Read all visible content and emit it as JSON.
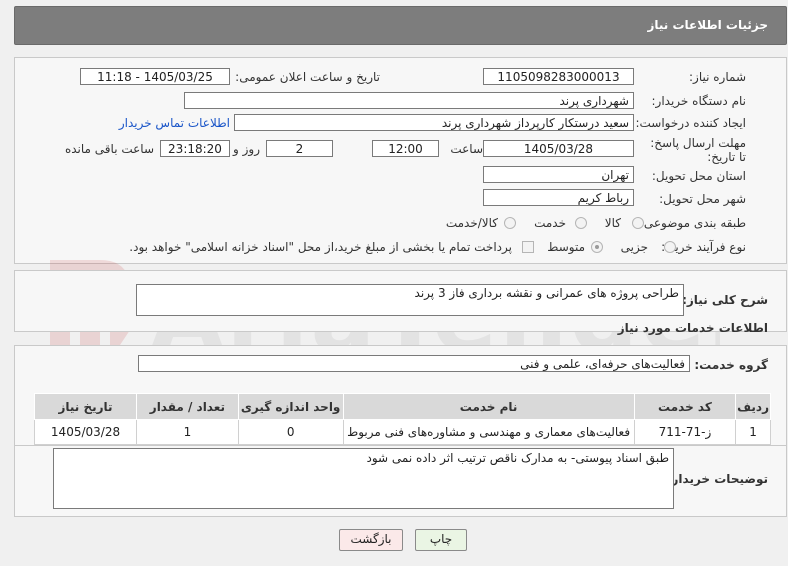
{
  "header": {
    "title": "جزئیات اطلاعات نیاز"
  },
  "form": {
    "need_number_label": "شماره نیاز:",
    "need_number": "1105098283000013",
    "announce_label": "تاریخ و ساعت اعلان عمومی:",
    "announce_value": "1405/03/25 - 11:18",
    "buyer_org_label": "نام دستگاه خریدار:",
    "buyer_org": "شهرداری پرند",
    "creator_label": "ایجاد کننده درخواست:",
    "creator": "سعید درستکار کارپرداز شهرداری پرند",
    "contact_link": "اطلاعات تماس خریدار",
    "deadline_label": "مهلت ارسال پاسخ: تا تاریخ:",
    "deadline_date": "1405/03/28",
    "time_label": "ساعت",
    "deadline_time": "12:00",
    "days_value": "2",
    "days_label": "روز و",
    "remaining_value": "23:18:20",
    "remaining_label": "ساعت باقی مانده",
    "province_label": "استان محل تحویل:",
    "province": "تهران",
    "city_label": "شهر محل تحویل:",
    "city": "رباط کریم",
    "category_label": "طبقه بندی موضوعی:",
    "category_options": [
      "کالا",
      "خدمت",
      "کالا/خدمت"
    ],
    "category_selected": "خدمت",
    "process_label": "نوع فرآیند خرید :",
    "process_options": [
      "جزیی",
      "متوسط"
    ],
    "process_selected": "متوسط",
    "payment_note": "پرداخت تمام یا بخشی از مبلغ خرید،از محل \"اسناد خزانه اسلامی\" خواهد بود."
  },
  "summary": {
    "label": "شرح کلی نیاز:",
    "value": "طراحی پروژه های عمرانی و نقشه برداری فاز 3 پرند"
  },
  "services": {
    "section_title": "اطلاعات خدمات مورد نیاز",
    "group_label": "گروه خدمت:",
    "group_value": "فعالیت‌های حرفه‌ای، علمی و فنی",
    "columns": [
      "ردیف",
      "کد خدمت",
      "نام خدمت",
      "واحد اندازه گیری",
      "تعداد / مقدار",
      "تاریخ نیاز"
    ],
    "rows": [
      [
        "1",
        "ز-71-711",
        "فعالیت‌های معماری و مهندسی و مشاوره‌های فنی مربوط",
        "0",
        "1",
        "1405/03/28"
      ]
    ]
  },
  "notes": {
    "label": "توضیحات خریدار:",
    "value": "طبق اسناد پیوستی- به مدارک ناقص ترتیب اثر داده نمی شود"
  },
  "buttons": {
    "print": "چاپ",
    "back": "بازگشت"
  },
  "watermark": {
    "text": "AriaTender.net"
  }
}
